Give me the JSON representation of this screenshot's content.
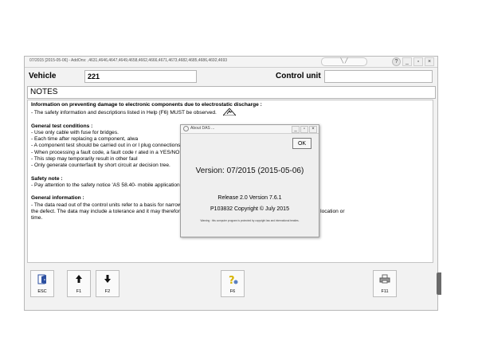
{
  "window": {
    "title": "07/2015 [2015-05-06] - AddOns:     ,4631,4646,4647,4649,4658,4662,4666,4671,4673,4682,4685,4686,4692,4693",
    "center_box": "╲  ╱"
  },
  "vehicle": {
    "label": "Vehicle",
    "value": "221"
  },
  "control_unit": {
    "label": "Control unit",
    "value": ""
  },
  "notes": {
    "title": "NOTES"
  },
  "content": {
    "section1_title": "Information on preventing damage to electronic components due to electrostatic discharge :",
    "section1_line1": "- The safety information and descriptions listed in Help (F6) MUST be observed.",
    "general_title": "General test conditions :",
    "general_lines": [
      "- Use only cable with fuse for bridges.",
      "- Each time after replacing a component, alwa",
      "- A component test should be carried out in or                                                                      l plug connections (electric or pneumatic).",
      "- When processing a fault code, a fault code r                                                                     ated in a YES/NO cell.",
      "- This step may temporarily result in other faul",
      "- Only generate counterfault by short circuit ar                                                                   decision tree."
    ],
    "safety_title": "Safety note :",
    "safety_line": "- Pay attention to the safety notice 'AS 58.40-                                                                   mobile applications.",
    "info_title": "General information :",
    "info_lines": [
      "- The data read out of the control units refer to                                                                  a basis for narrowing down the source of",
      "  the defect. The data may include a tolerance and it may therefore not necessarily be possible to link them to a certain event, location or",
      "  time."
    ]
  },
  "dialog": {
    "title": "About DAS ...",
    "ok_label": "OK",
    "version": "Version: 07/2015 (2015-05-06)",
    "release": "Release 2.0 Version 7.6.1",
    "copyright": "P103832 Copyright © July 2015",
    "warning": "Warning : this computer program is protected by copyright law and international treaties."
  },
  "toolbar": {
    "buttons": [
      {
        "label": "ESC",
        "icon": "exit-icon"
      },
      {
        "label": "F1",
        "icon": "arrow-up-icon"
      },
      {
        "label": "F2",
        "icon": "arrow-down-icon"
      },
      {
        "label": "F6",
        "icon": "help-icon"
      },
      {
        "label": "F11",
        "icon": "printer-icon"
      }
    ]
  },
  "colors": {
    "accent_help": "#d8b400",
    "exit_blue": "#2b4fa0"
  }
}
